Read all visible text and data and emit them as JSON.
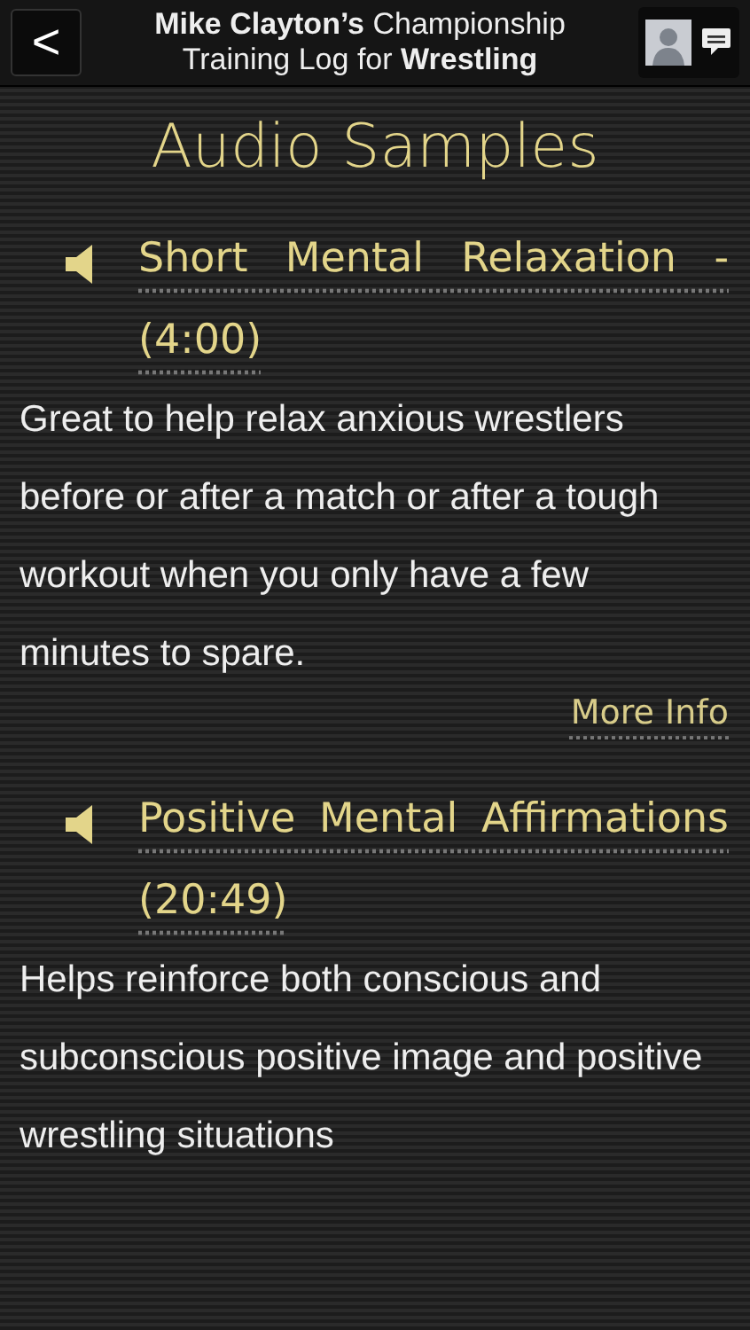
{
  "header": {
    "back_label": "<",
    "title_line_1": "**Mike Clayton’s** Championship",
    "title_line_2": "Training Log for **Wrestling**"
  },
  "heading": "Audio Samples",
  "samples": [
    {
      "title": "Short Mental Relaxation - (4:00)",
      "description": "Great to help relax anxious wrestlers before or after a match or after a tough workout when you only have a few minutes to spare.",
      "more_info": "More Info"
    },
    {
      "title": "Positive Mental Affirmations (20:49)",
      "description": "Helps reinforce both conscious and subconscious positive image and positive wrestling situations"
    }
  ]
}
